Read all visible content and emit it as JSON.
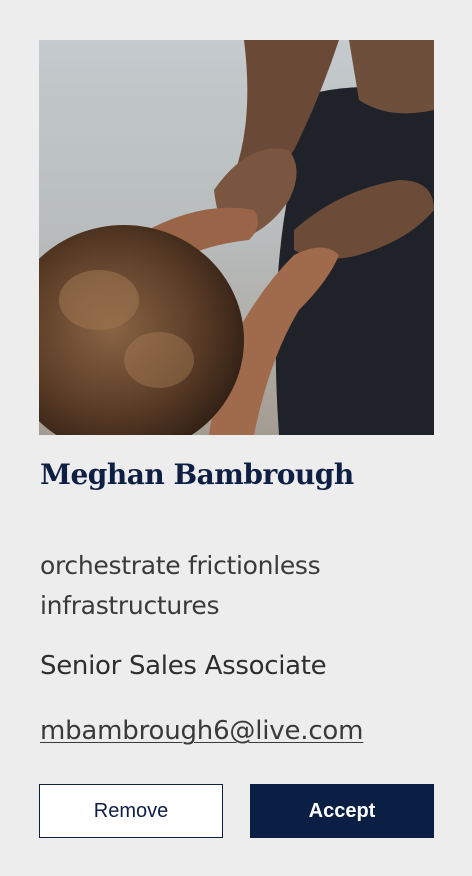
{
  "profile": {
    "name": "Meghan Bambrough",
    "tagline": "orchestrate frictionless infrastructures",
    "role": "Senior Sales Associate",
    "email": "mbambrough6@live.com"
  },
  "actions": {
    "remove_label": "Remove",
    "accept_label": "Accept"
  },
  "colors": {
    "background": "#ededed",
    "accent": "#0b1f45",
    "name_text": "#0f1f44",
    "body_text": "#333333"
  }
}
